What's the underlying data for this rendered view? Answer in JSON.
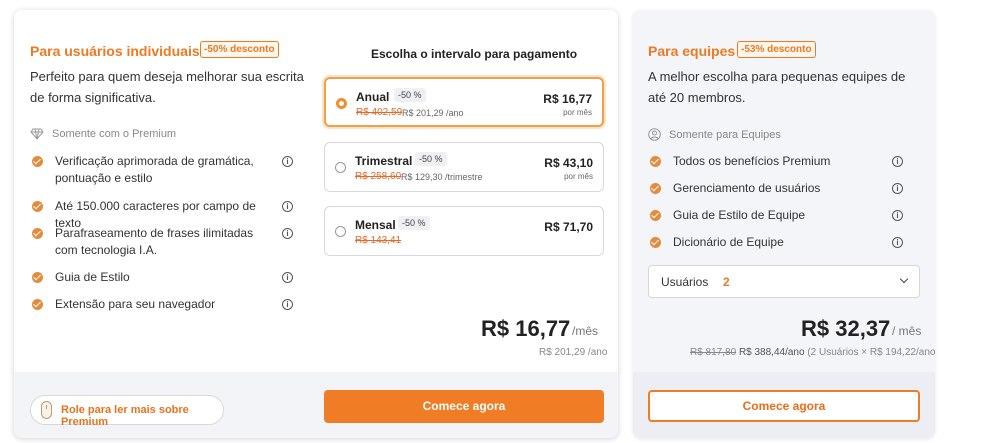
{
  "individual": {
    "title": "Para usuários individuais",
    "discount_badge": "-50% desconto",
    "description": "Perfeito para quem deseja melhorar sua escrita de forma significativa.",
    "note": "Somente com o Premium",
    "features": [
      {
        "label": "Verificação aprimorada de gramática, pontuação e estilo"
      },
      {
        "label": "Até 150.000 caracteres por campo de texto"
      },
      {
        "label": "Parafraseamento de frases ilimitadas com tecnologia I.A."
      },
      {
        "label": "Guia de Estilo"
      },
      {
        "label": "Extensão para seu navegador"
      }
    ],
    "interval_title": "Escolha o intervalo para pagamento",
    "options": [
      {
        "name": "Anual",
        "discount": "-50 %",
        "old_price": "R$ 402,59",
        "yearly": "R$ 201,29 /ano",
        "price": "R$ 16,77",
        "per": "por mês",
        "selected": true
      },
      {
        "name": "Trimestral",
        "discount": "-50 %",
        "old_price": "R$ 258,60",
        "yearly": "R$ 129,30 /trimestre",
        "price": "R$ 43,10",
        "per": "por mês",
        "selected": false
      },
      {
        "name": "Mensal",
        "discount": "-50 %",
        "old_price": "R$ 143,41",
        "yearly": "",
        "price": "R$ 71,70",
        "per": "",
        "selected": false
      }
    ],
    "total_price": "R$ 16,77",
    "total_per": "/mês",
    "total_year": "R$ 201,29 /ano",
    "scroll_label": "Role para ler mais sobre Premium",
    "cta": "Comece agora"
  },
  "team": {
    "title": "Para equipes",
    "discount_badge": "-53% desconto",
    "description": "A melhor escolha para pequenas equipes de até 20 membros.",
    "note": "Somente para Equipes",
    "features": [
      {
        "label": "Todos os benefícios Premium"
      },
      {
        "label": "Gerenciamento de usuários"
      },
      {
        "label": "Guia de Estilo de Equipe"
      },
      {
        "label": "Dicionário de Equipe"
      }
    ],
    "users_label": "Usuários",
    "users_count": "2",
    "total_price": "R$ 32,37",
    "total_per": "/ mês",
    "old_year": "R$ 817,80",
    "year_price": "R$ 388,44/ano",
    "year_detail": "(2 Usuários × R$ 194,22/ano)",
    "cta": "Comece agora"
  },
  "colors": {
    "accent": "#f07d25",
    "discount_strike": "#e36b2a",
    "card_team_bg": "#f4f5f9"
  },
  "icons": {
    "premium_note": "diamond-icon",
    "team_note": "user-circle-icon",
    "feature": "check-circle-icon",
    "info": "info-icon",
    "scroll": "mouse-icon",
    "select": "chevron-down-icon"
  }
}
